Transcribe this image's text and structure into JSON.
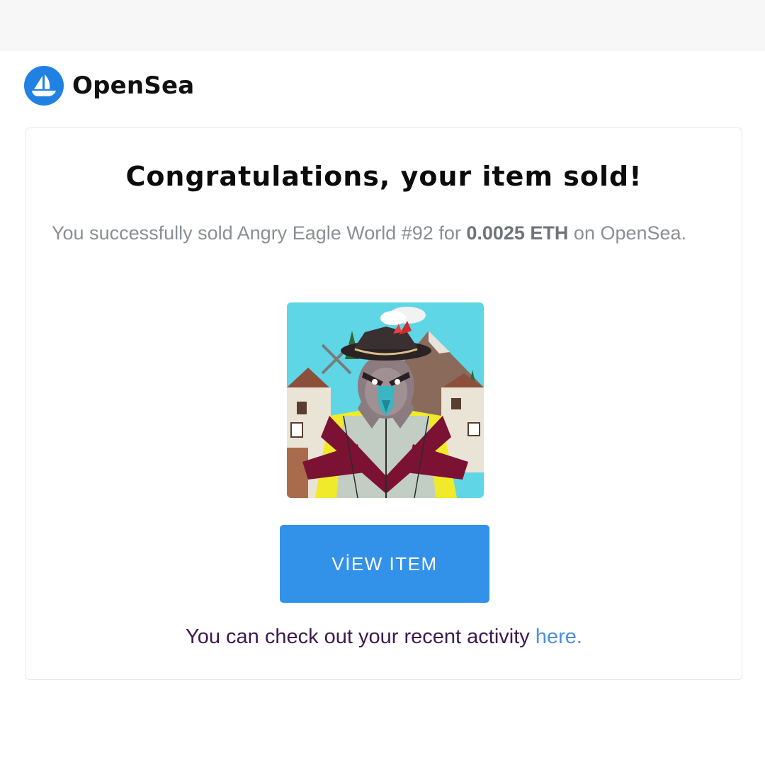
{
  "brand": {
    "name": "OpenSea",
    "accent_color": "#2081e2",
    "logo_icon": "opensea-ship-icon"
  },
  "email": {
    "title": "Congratulations, your item sold!",
    "message_prefix": "You successfully sold Angry Eagle World #92 for ",
    "price": "0.0025 ETH",
    "message_suffix": " on OpenSea."
  },
  "item": {
    "image_icon": "angry-eagle-nft-image"
  },
  "button": {
    "label": "VİEW ITEM",
    "color": "#3291e9"
  },
  "footer": {
    "text": "You can check out your recent activity ",
    "link_label": "here",
    "trailing": "."
  }
}
